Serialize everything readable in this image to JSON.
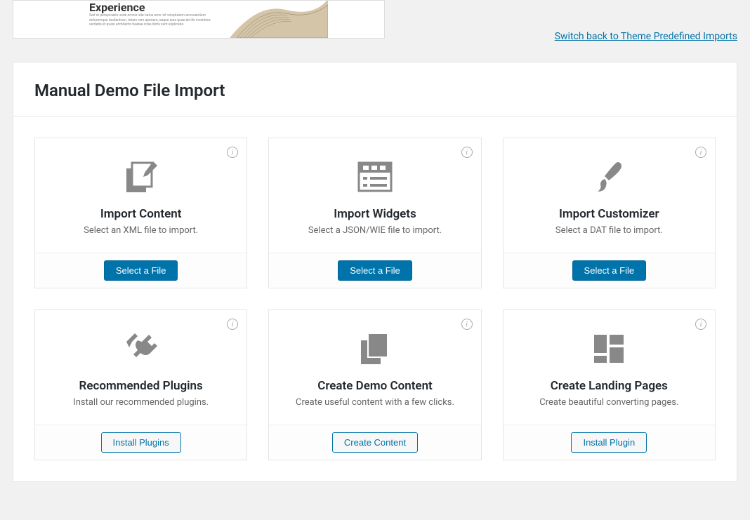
{
  "top": {
    "preview_heading": "Experience",
    "switch_link": "Switch back to Theme Predefined Imports"
  },
  "panel": {
    "title": "Manual Demo File Import"
  },
  "cards": [
    {
      "title": "Import Content",
      "desc": "Select an XML file to import.",
      "button": "Select a File",
      "button_style": "primary",
      "icon": "file-edit"
    },
    {
      "title": "Import Widgets",
      "desc": "Select a JSON/WIE file to import.",
      "button": "Select a File",
      "button_style": "primary",
      "icon": "widgets"
    },
    {
      "title": "Import Customizer",
      "desc": "Select a DAT file to import.",
      "button": "Select a File",
      "button_style": "primary",
      "icon": "brush"
    },
    {
      "title": "Recommended Plugins",
      "desc": "Install our recommended plugins.",
      "button": "Install Plugins",
      "button_style": "secondary",
      "icon": "plugin"
    },
    {
      "title": "Create Demo Content",
      "desc": "Create useful content with a few clicks.",
      "button": "Create Content",
      "button_style": "secondary",
      "icon": "pages"
    },
    {
      "title": "Create Landing Pages",
      "desc": "Create beautiful converting pages.",
      "button": "Install Plugin",
      "button_style": "secondary",
      "icon": "layout"
    }
  ]
}
